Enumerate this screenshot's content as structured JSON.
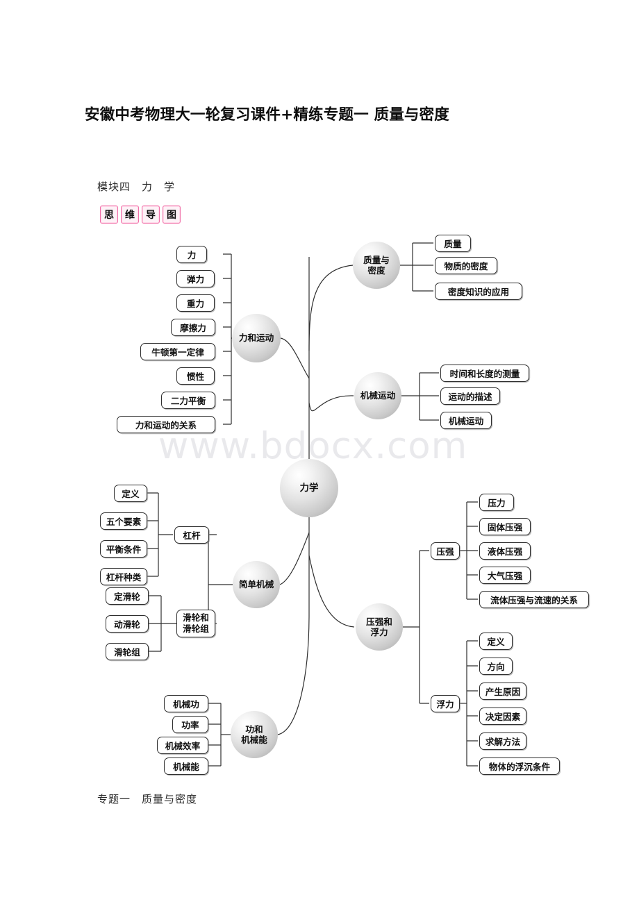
{
  "document": {
    "title": "安徽中考物理大一轮复习课件+精练专题一 质量与密度",
    "module_line": "模块四　力　学",
    "footer_line": "专题一　质量与密度",
    "watermark": "www.bdocx.com",
    "badge_chars": [
      "思",
      "维",
      "导",
      "图"
    ],
    "badge_color": "#f06fa8"
  },
  "mindmap": {
    "center": {
      "label": "力学"
    },
    "branches": [
      {
        "id": "force-motion",
        "label": "力和运动",
        "children": [
          {
            "label": "力"
          },
          {
            "label": "弹力"
          },
          {
            "label": "重力"
          },
          {
            "label": "摩擦力"
          },
          {
            "label": "牛顿第一定律"
          },
          {
            "label": "惯性"
          },
          {
            "label": "二力平衡"
          },
          {
            "label": "力和运动的关系"
          }
        ]
      },
      {
        "id": "mass-density",
        "label": "质量与密度",
        "label_lines": [
          "质量与",
          "密度"
        ],
        "children": [
          {
            "label": "质量"
          },
          {
            "label": "物质的密度"
          },
          {
            "label": "密度知识的应用"
          }
        ]
      },
      {
        "id": "mechanical-motion",
        "label": "机械运动",
        "children": [
          {
            "label": "时间和长度的测量"
          },
          {
            "label": "运动的描述"
          },
          {
            "label": "机械运动"
          }
        ]
      },
      {
        "id": "simple-machines",
        "label": "简单机械",
        "groups": [
          {
            "label": "杠杆",
            "children": [
              {
                "label": "定义"
              },
              {
                "label": "五个要素"
              },
              {
                "label": "平衡条件"
              },
              {
                "label": "杠杆种类"
              }
            ]
          },
          {
            "label": "滑轮和滑轮组",
            "label_lines": [
              "滑轮和",
              "滑轮组"
            ],
            "children": [
              {
                "label": "定滑轮"
              },
              {
                "label": "动滑轮"
              },
              {
                "label": "滑轮组"
              }
            ]
          }
        ]
      },
      {
        "id": "work-energy",
        "label": "功和机械能",
        "label_lines": [
          "功和",
          "机械能"
        ],
        "children": [
          {
            "label": "机械功"
          },
          {
            "label": "功率"
          },
          {
            "label": "机械效率"
          },
          {
            "label": "机械能"
          }
        ]
      },
      {
        "id": "pressure-buoyancy",
        "label": "压强和浮力",
        "label_lines": [
          "压强和",
          "浮力"
        ],
        "groups": [
          {
            "label": "压强",
            "children": [
              {
                "label": "压力"
              },
              {
                "label": "固体压强"
              },
              {
                "label": "液体压强"
              },
              {
                "label": "大气压强"
              },
              {
                "label": "流体压强与流速的关系"
              }
            ]
          },
          {
            "label": "浮力",
            "children": [
              {
                "label": "定义"
              },
              {
                "label": "方向"
              },
              {
                "label": "产生原因"
              },
              {
                "label": "决定因素"
              },
              {
                "label": "求解方法"
              },
              {
                "label": "物体的浮沉条件"
              }
            ]
          }
        ]
      }
    ]
  }
}
